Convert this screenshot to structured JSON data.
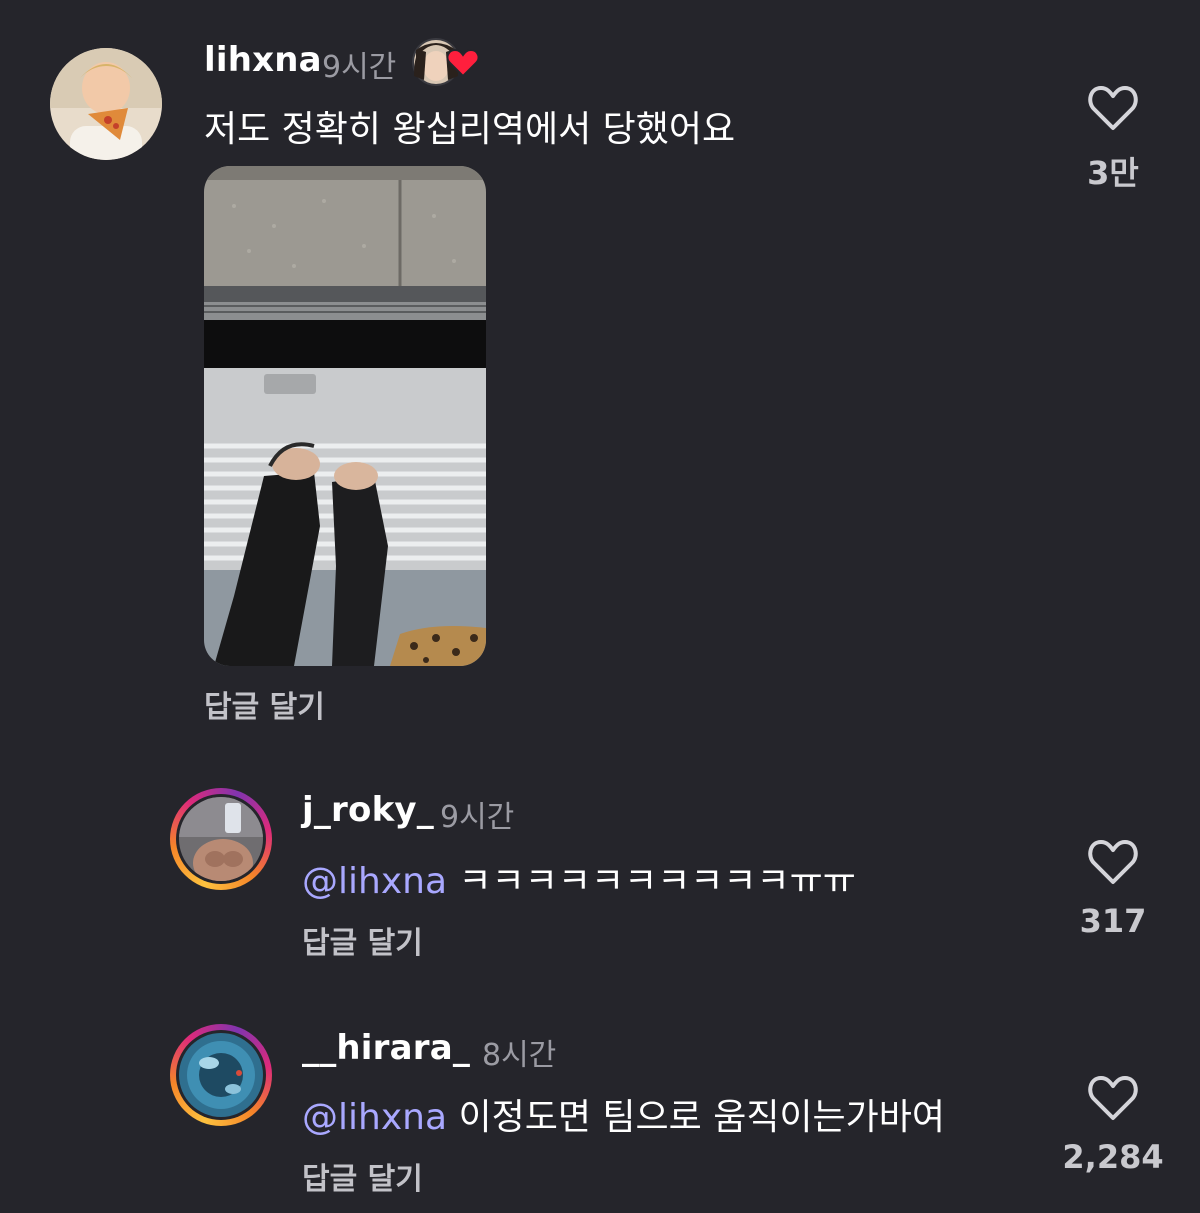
{
  "comments": [
    {
      "username": "lihxna",
      "time": "9시간",
      "text": "저도 정확히 왕십리역에서 당했어요",
      "reply_label": "답글 달기",
      "likes": "3만"
    },
    {
      "username": "j_roky_",
      "time": "9시간",
      "mention": "@lihxna",
      "text": "ㅋㅋㅋㅋㅋㅋㅋㅋㅋㅋㅠㅠ",
      "reply_label": "답글 달기",
      "likes": "317"
    },
    {
      "username": "__hirara_",
      "time": "8시간",
      "mention": "@lihxna",
      "text": "이정도면 팀으로 움직이는가바여",
      "reply_label": "답글 달기",
      "likes": "2,284"
    }
  ],
  "colors": {
    "background": "#25252b",
    "mention": "#a9a8ff",
    "secondary_text": "#9b9ba3",
    "creator_heart": "#ff1f3d"
  },
  "icons": {
    "like": "heart-outline-icon",
    "creator_liked": "creator-heart-badge"
  }
}
